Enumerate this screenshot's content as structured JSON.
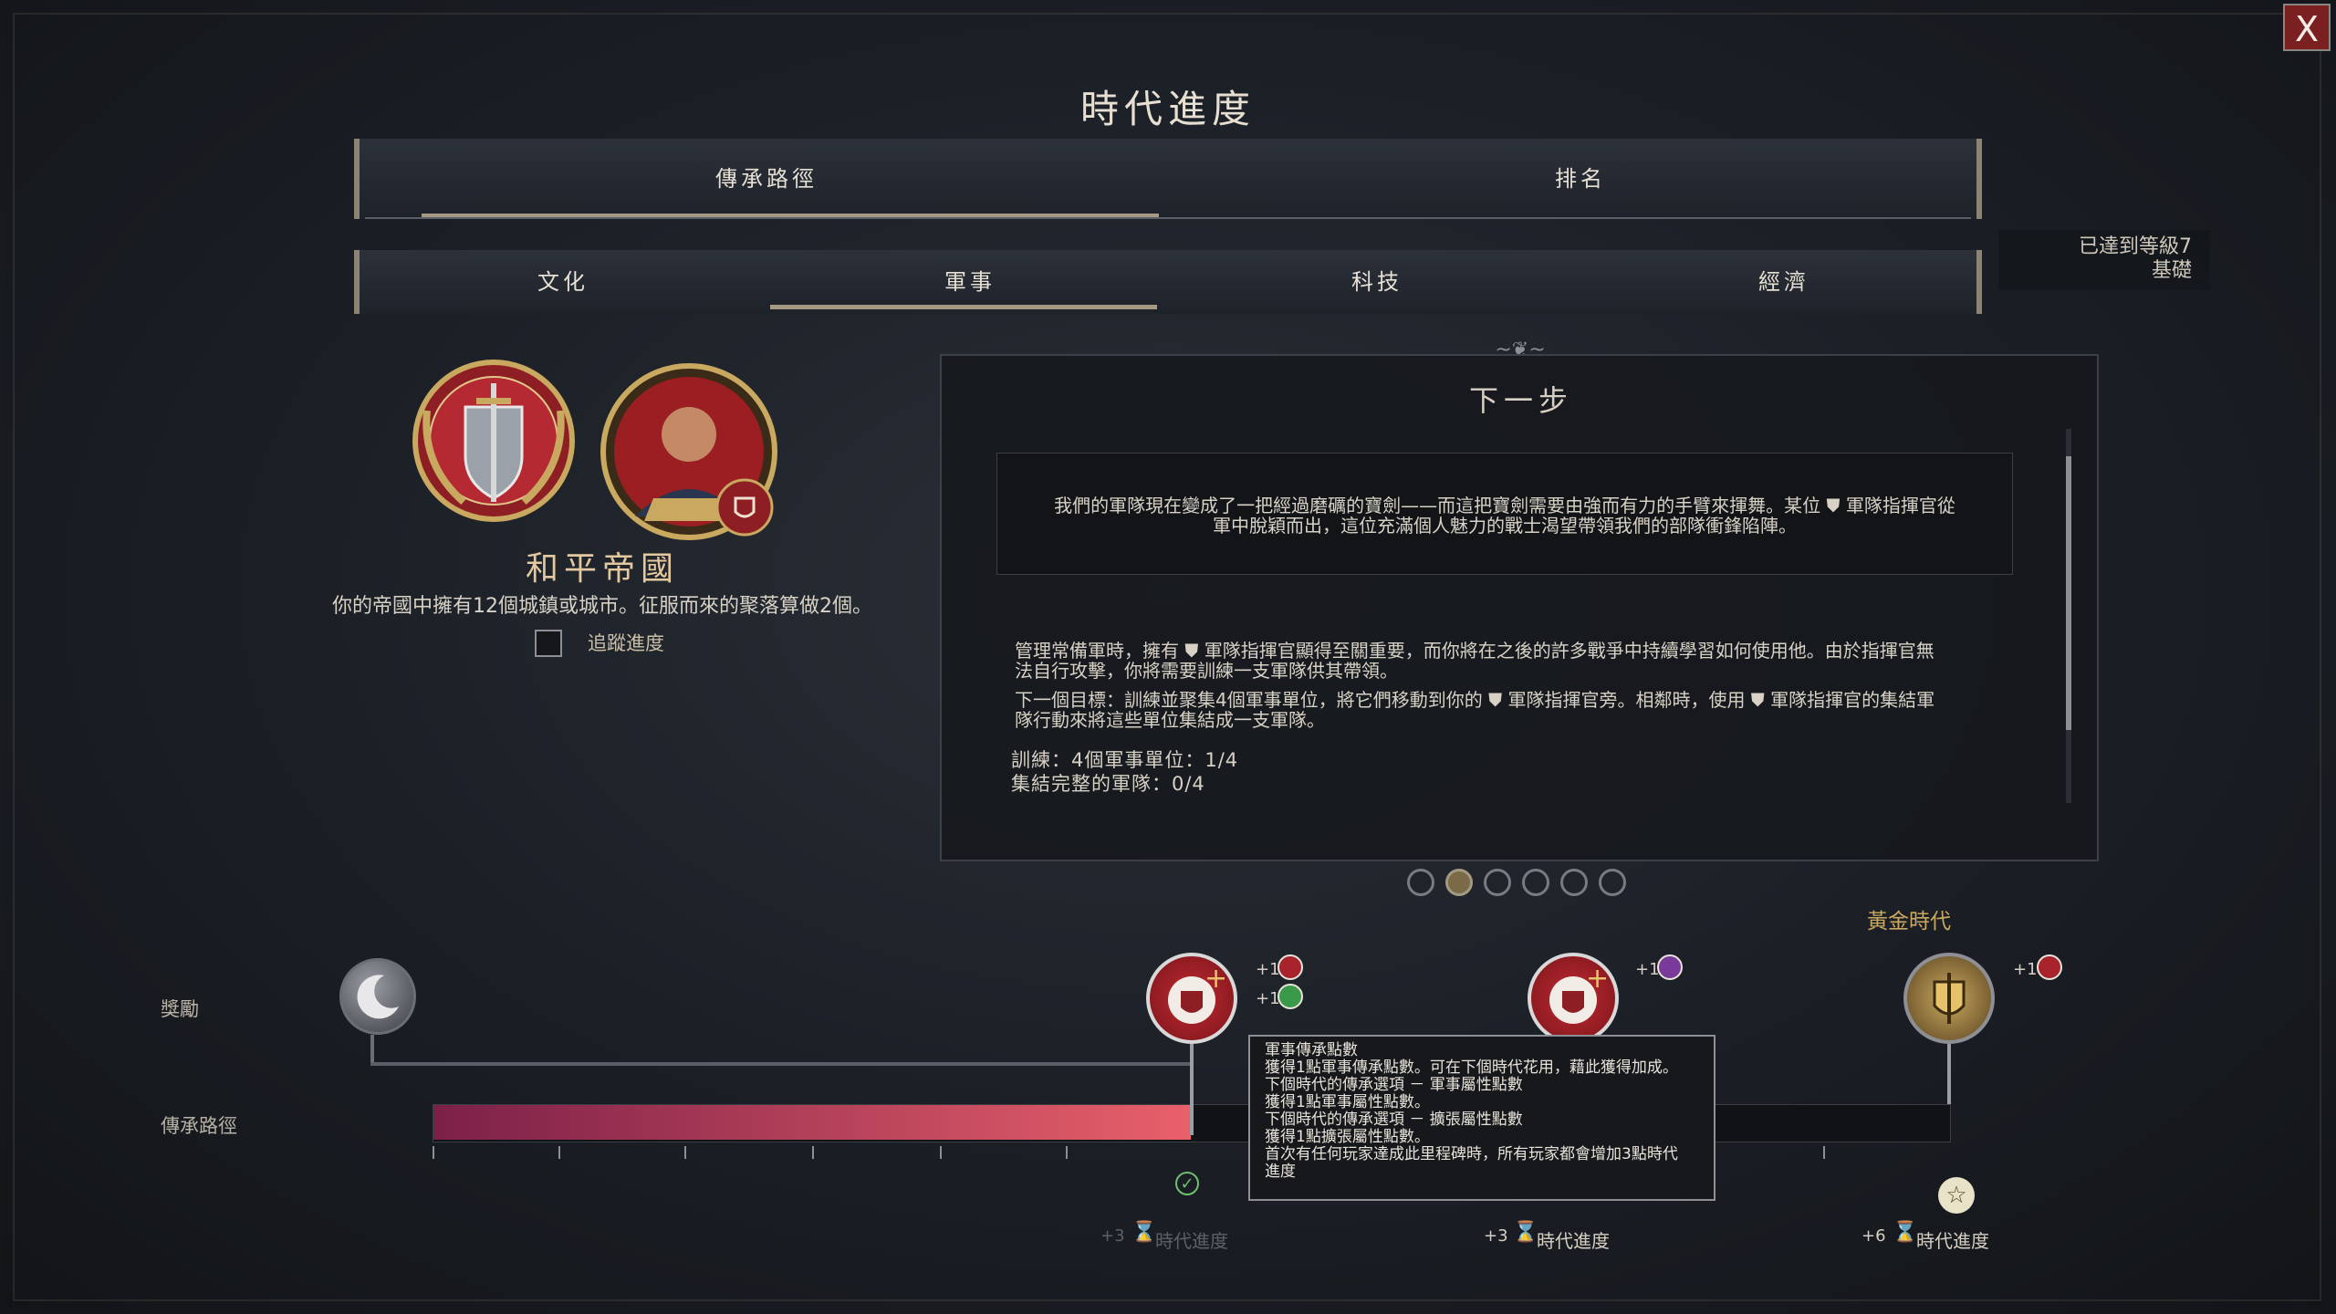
{
  "window": {
    "title": "時代進度",
    "close_label": "X"
  },
  "top_tabs": [
    {
      "label": "傳承路徑",
      "active": true
    },
    {
      "label": "排名",
      "active": false
    }
  ],
  "sub_tabs": [
    {
      "label": "文化",
      "active": false
    },
    {
      "label": "軍事",
      "active": true
    },
    {
      "label": "科技",
      "active": false
    },
    {
      "label": "經濟",
      "active": false
    }
  ],
  "level_status": {
    "line1": "已達到等級7",
    "line2": "基礎"
  },
  "path": {
    "name": "和平帝國",
    "description": "你的帝國中擁有12個城鎮或城市。征服而來的聚落算做2個。",
    "track_label": "追蹤進度"
  },
  "next_step": {
    "heading": "下一步",
    "quote_line1": "我們的軍隊現在變成了一把經過磨礪的寶劍——而這把寶劍需要由強而有力的手臂來揮舞。某位 ⛊ 軍隊指揮官從",
    "quote_line2": "軍中脫穎而出，這位充滿個人魅力的戰士渴望帶領我們的部隊衝鋒陷陣。",
    "para1_line1": "管理常備軍時，擁有 ⛊ 軍隊指揮官顯得至關重要，而你將在之後的許多戰爭中持續學習如何使用他。由於指揮官無",
    "para1_line2": "法自行攻擊，你將需要訓練一支軍隊供其帶領。",
    "para2_line1": "下一個目標：訓練並聚集4個軍事單位，將它們移動到你的 ⛊ 軍隊指揮官旁。相鄰時，使用 ⛊ 軍隊指揮官的集結軍",
    "para2_line2": "隊行動來將這些單位集結成一支軍隊。",
    "objective1": "訓練：4個軍事單位：1/4",
    "objective2": "集結完整的軍隊：0/4"
  },
  "pagination": {
    "count": 6,
    "active_index": 1
  },
  "rows": {
    "rewards_label": "獎勵",
    "path_label": "傳承路徑"
  },
  "golden_age_label": "黃金時代",
  "milestones": [
    {
      "reward_a": "+1",
      "reward_b": "+1",
      "era": "+3",
      "era_label": "時代進度",
      "completed": true
    },
    {
      "reward_a": "+1",
      "era": "+3",
      "era_label": "時代進度",
      "completed": false
    },
    {
      "reward_a": "+1",
      "era": "+6",
      "era_label": "時代進度",
      "completed": false
    }
  ],
  "progress": {
    "fraction": 0.5
  },
  "tooltip": {
    "title": "軍事傳承點數",
    "line1": "獲得1點軍事傳承點數。可在下個時代花用，藉此獲得加成。",
    "line2": "下個時代的傳承選項 － 軍事屬性點數",
    "line3": "獲得1點軍事屬性點數。",
    "line4": "下個時代的傳承選項 － 擴張屬性點數",
    "line5": "獲得1點擴張屬性點數。",
    "line6": "首次有任何玩家達成此里程碑時，所有玩家都會增加3點時代",
    "line7": "進度"
  },
  "colors": {
    "progress_start": "#7c2048",
    "progress_end": "#e8606a",
    "accent_gold": "#c9a860",
    "military_red": "#a8232b"
  }
}
